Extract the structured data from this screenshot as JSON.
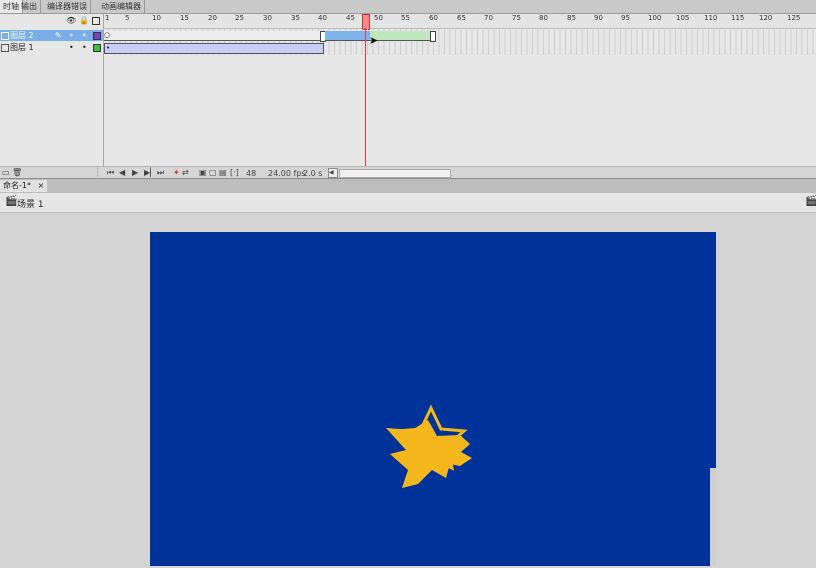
{
  "tabs": [
    "时轴",
    "输出",
    "编译器错误",
    "动画编辑器"
  ],
  "layers": [
    {
      "name": "图层 2",
      "selected": true,
      "color": "#7a3fc4"
    },
    {
      "name": "图层 1",
      "selected": false,
      "color": "#3fbf3f"
    }
  ],
  "ruler_ticks": [
    "1",
    "5",
    "10",
    "15",
    "20",
    "25",
    "30",
    "35",
    "40",
    "45",
    "50",
    "55",
    "60",
    "65",
    "70",
    "75",
    "80",
    "85",
    "90",
    "95",
    "100",
    "105",
    "110",
    "115",
    "120",
    "125"
  ],
  "playhead_frame": "48",
  "status": {
    "frame": "48",
    "fps": "24.00 fps",
    "time": "2.0 s"
  },
  "document_tab": "命名-1*",
  "document_close": "×",
  "scene": "场景 1",
  "colors": {
    "stage": "#003399",
    "star": "#f5b81c",
    "layer_selected": "#7aaee8",
    "tween_blue": "#7fb4ec",
    "tween_green": "#bfe6bf"
  }
}
